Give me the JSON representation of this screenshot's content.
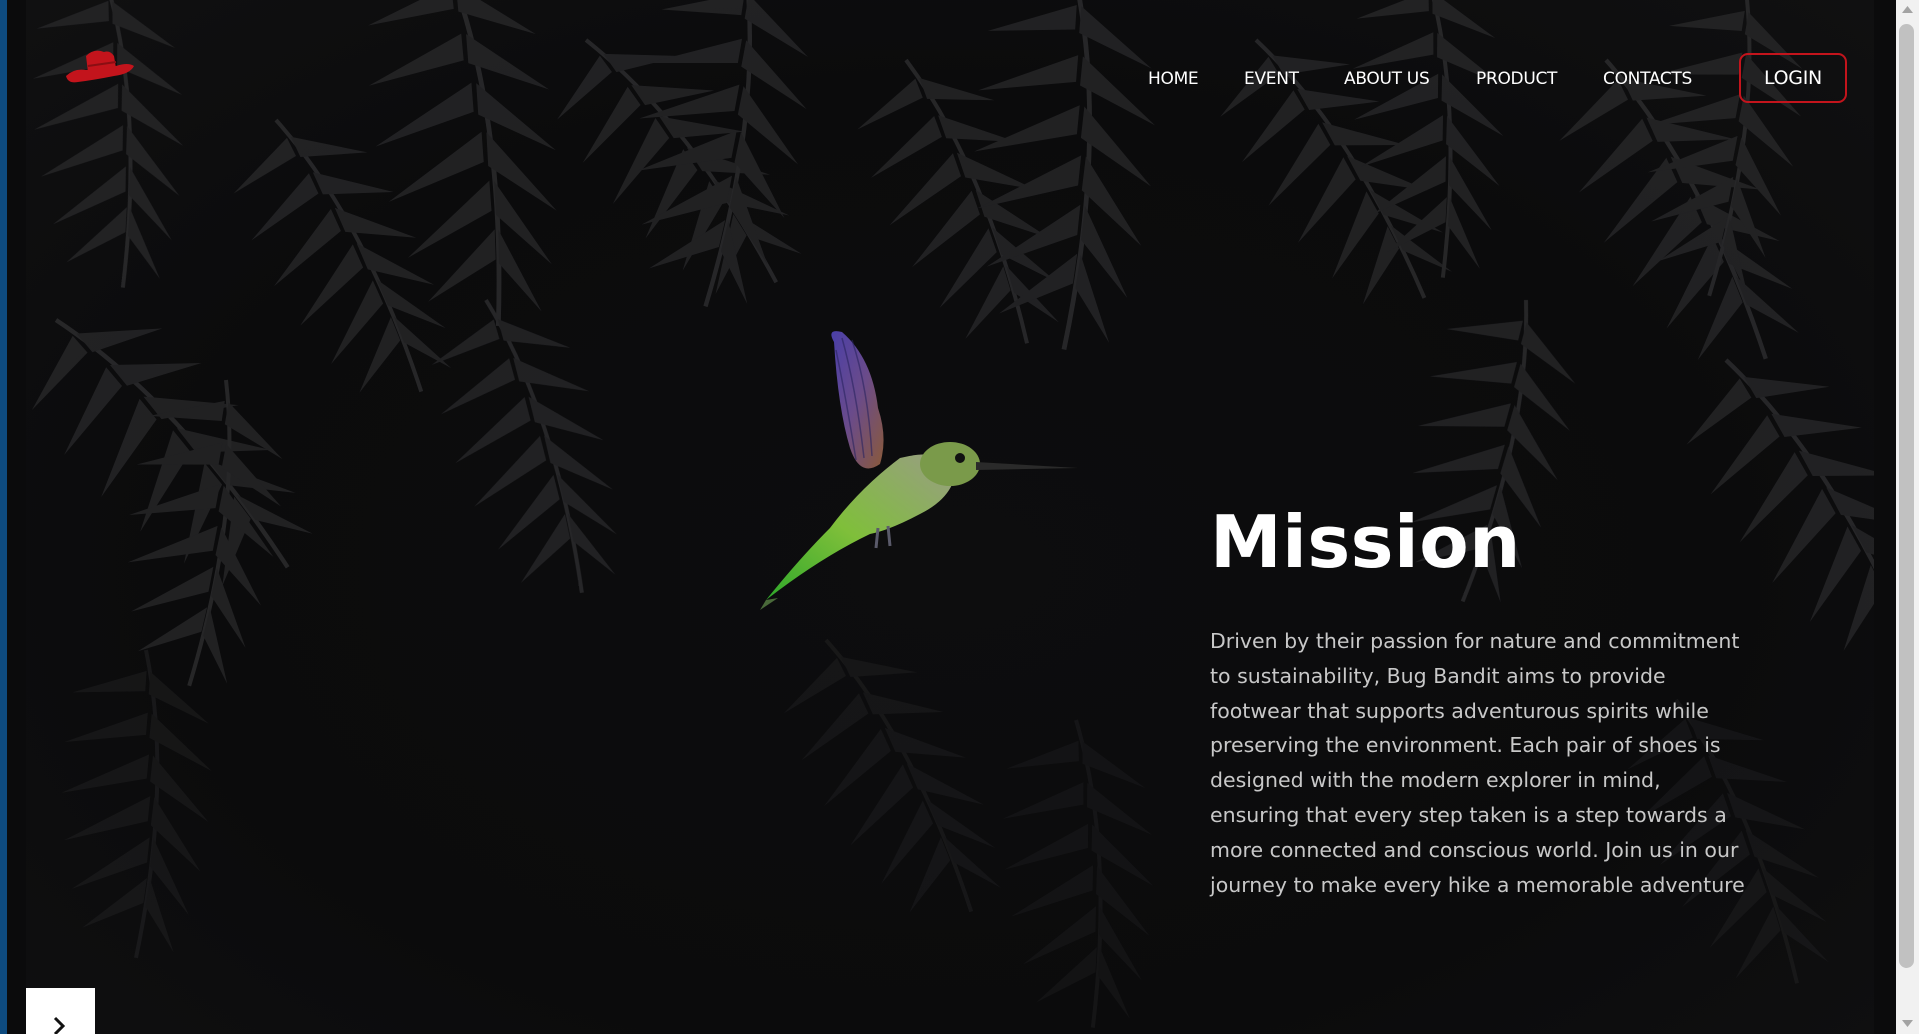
{
  "brand": {
    "logo_icon": "cowboy-hat-icon",
    "accent_color": "#c3141c"
  },
  "nav": {
    "items": [
      {
        "label": "HOME"
      },
      {
        "label": "EVENT"
      },
      {
        "label": "ABOUT US"
      },
      {
        "label": "PRODUCT"
      },
      {
        "label": "CONTACTS"
      }
    ],
    "login_label": "LOGIN"
  },
  "hero": {
    "image_icon": "hummingbird-image",
    "title": "Mission",
    "body": "Driven by their passion for nature and commitment to sustainability, Bug Bandit aims to provide footwear that supports adventurous spirits while preserving the environment. Each pair of shoes is designed with the modern explorer in mind, ensuring that every step taken is a step towards a more connected and conscious world. Join us in our journey to make every hike a memorable adventure"
  },
  "carousel": {
    "next_icon": "chevron-right-icon"
  }
}
